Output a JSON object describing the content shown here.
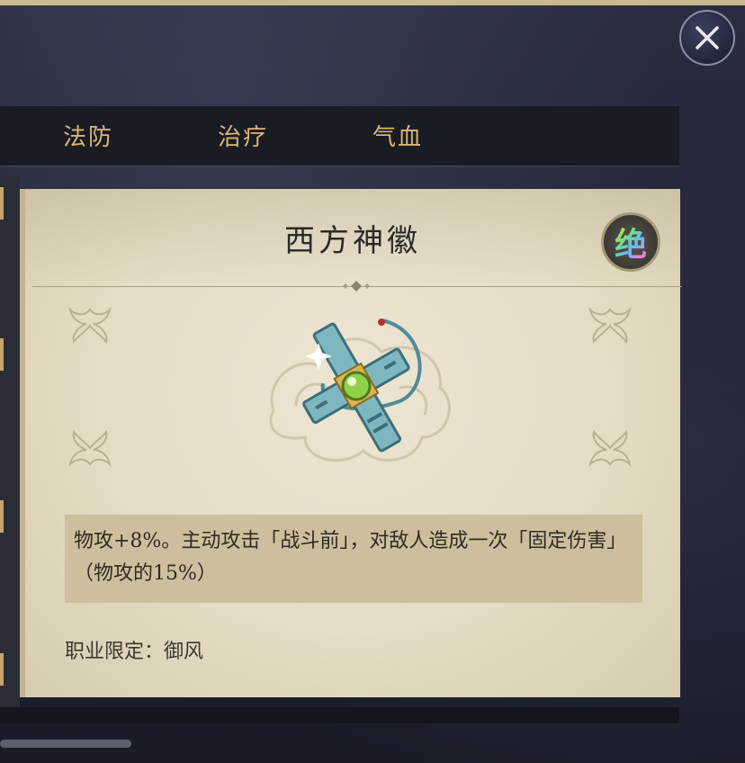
{
  "close_button": {
    "icon": "close-icon"
  },
  "tabs": [
    {
      "label": "法防"
    },
    {
      "label": "治疗"
    },
    {
      "label": "气血"
    }
  ],
  "item": {
    "name": "西方神徽",
    "rank_label": "绝",
    "image_icon": "cross-emblem-icon",
    "description": "物攻+8%。主动攻击「战斗前」，对敌人造成一次「固定伤害」（物攻的15%）",
    "restriction": "职业限定：御风"
  },
  "colors": {
    "tab_text": "#d9b676",
    "card_bg": "#e4dcc5",
    "desc_bg": "#cdbf9d",
    "title_text": "#2b2a27"
  }
}
